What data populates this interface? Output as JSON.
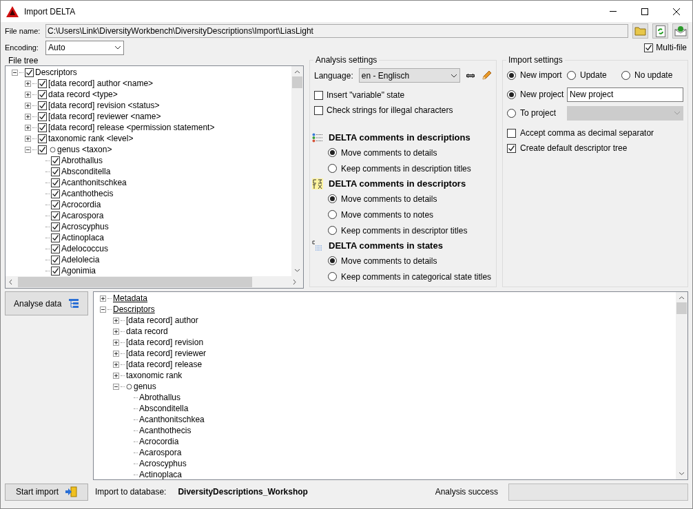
{
  "window": {
    "title": "Import DELTA"
  },
  "file_name": {
    "label": "File name:",
    "value": "C:\\Users\\Link\\DiversityWorkbench\\DiversityDescriptions\\Import\\LiasLight"
  },
  "encoding": {
    "label": "Encoding:",
    "value": "Auto"
  },
  "multi_file": {
    "label": "Multi-file",
    "checked": true
  },
  "file_tree": {
    "title": "File tree",
    "nodes": [
      {
        "label": "Descriptors",
        "checked": true,
        "expanded": true,
        "children": [
          {
            "label": "[data record] author <name>",
            "checked": true,
            "expanded": false
          },
          {
            "label": "data record <type>",
            "checked": true,
            "expanded": false
          },
          {
            "label": "[data record] revision <status>",
            "checked": true,
            "expanded": false
          },
          {
            "label": "[data record] reviewer <name>",
            "checked": true,
            "expanded": false
          },
          {
            "label": "[data record] release <permission statement>",
            "checked": true,
            "expanded": false
          },
          {
            "label": "taxonomic rank <level>",
            "checked": true,
            "expanded": false
          },
          {
            "label": "genus <taxon>",
            "checked": true,
            "expanded": true,
            "circled": true,
            "children": [
              {
                "label": "Abrothallus",
                "checked": true
              },
              {
                "label": "Absconditella",
                "checked": true
              },
              {
                "label": "Acanthonitschkea",
                "checked": true
              },
              {
                "label": "Acanthothecis",
                "checked": true
              },
              {
                "label": "Acrocordia",
                "checked": true
              },
              {
                "label": "Acarospora",
                "checked": true
              },
              {
                "label": "Acroscyphus",
                "checked": true
              },
              {
                "label": "Actinoplaca",
                "checked": true
              },
              {
                "label": "Adelococcus",
                "checked": true
              },
              {
                "label": "Adelolecia",
                "checked": true
              },
              {
                "label": "Agonimia",
                "checked": true
              }
            ]
          }
        ]
      }
    ]
  },
  "analysis_settings": {
    "title": "Analysis settings",
    "language": {
      "label": "Language:",
      "value": "en - Englisch"
    },
    "options": [
      {
        "label": "Insert \"variable\" state",
        "checked": false
      },
      {
        "label": "Check strings for illegal characters",
        "checked": false
      }
    ],
    "comment_groups": [
      {
        "title": "DELTA comments in descriptions",
        "options": [
          {
            "label": "Move comments to details",
            "selected": true
          },
          {
            "label": "Keep comments in description titles",
            "selected": false
          }
        ]
      },
      {
        "title": "DELTA comments in descriptors",
        "options": [
          {
            "label": "Move comments to details",
            "selected": true
          },
          {
            "label": "Move comments to notes",
            "selected": false
          },
          {
            "label": "Keep comments in descriptor titles",
            "selected": false
          }
        ]
      },
      {
        "title": "DELTA comments in states",
        "options": [
          {
            "label": "Move comments to details",
            "selected": true
          },
          {
            "label": "Keep comments in categorical state titles",
            "selected": false
          }
        ]
      }
    ]
  },
  "import_settings": {
    "title": "Import settings",
    "modes": [
      {
        "label": "New import",
        "selected": true
      },
      {
        "label": "Update",
        "selected": false
      },
      {
        "label": "No update",
        "selected": false
      }
    ],
    "targets": [
      {
        "label": "New project",
        "selected": true,
        "kind": "text",
        "value": "New project"
      },
      {
        "label": "To project",
        "selected": false,
        "kind": "dropdown",
        "disabled": true
      }
    ],
    "options": [
      {
        "label": "Accept comma as decimal separator",
        "checked": false
      },
      {
        "label": "Create default descriptor tree",
        "checked": true
      }
    ]
  },
  "analyse_button": {
    "label": "Analyse data"
  },
  "analysis_tree": [
    {
      "label": "Metadata",
      "expanded": false
    },
    {
      "label": "Descriptors",
      "expanded": true,
      "children": [
        {
          "label": "[data record] author",
          "expanded": false
        },
        {
          "label": "data record",
          "expanded": false
        },
        {
          "label": "[data record] revision",
          "expanded": false
        },
        {
          "label": "[data record] reviewer",
          "expanded": false
        },
        {
          "label": "[data record] release",
          "expanded": false
        },
        {
          "label": "taxonomic rank",
          "expanded": false
        },
        {
          "label": "genus",
          "expanded": true,
          "circled": true,
          "children": [
            {
              "label": "Abrothallus"
            },
            {
              "label": "Absconditella"
            },
            {
              "label": "Acanthonitschkea"
            },
            {
              "label": "Acanthothecis"
            },
            {
              "label": "Acrocordia"
            },
            {
              "label": "Acarospora"
            },
            {
              "label": "Acroscyphus"
            },
            {
              "label": "Actinoplaca"
            }
          ]
        }
      ]
    }
  ],
  "start_import_button": {
    "label": "Start import"
  },
  "database": {
    "label": "Import to database:",
    "value": "DiversityDescriptions_Workshop"
  },
  "analysis_success": {
    "label": "Analysis success",
    "level": 0
  }
}
